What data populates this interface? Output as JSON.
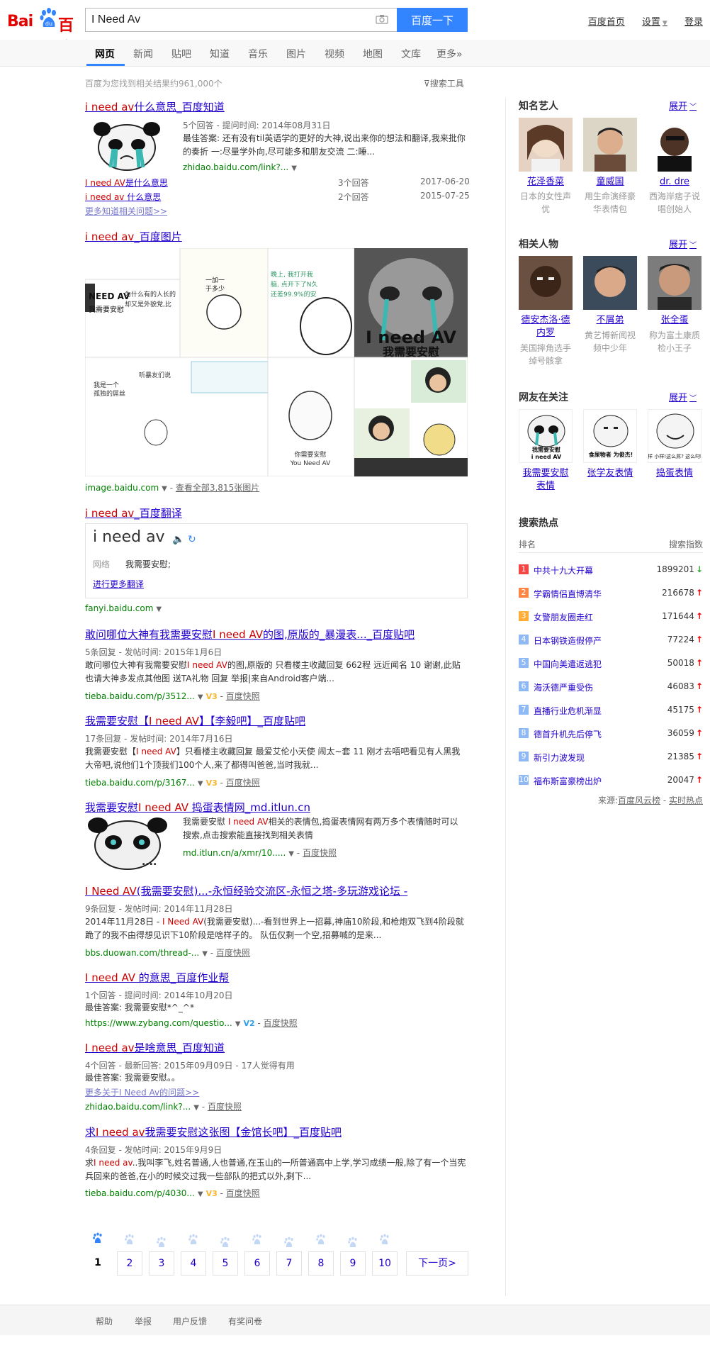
{
  "header": {
    "logo_left": "Bai",
    "logo_paw_text": "du",
    "logo_right": "百度",
    "search_value": "I Need Av",
    "search_button": "百度一下",
    "links": [
      "百度首页",
      "设置",
      "登录"
    ]
  },
  "tabs": [
    "网页",
    "新闻",
    "贴吧",
    "知道",
    "音乐",
    "图片",
    "视频",
    "地图",
    "文库",
    "更多»"
  ],
  "result_count": "百度为您找到相关结果约961,000个",
  "search_tools": "搜索工具",
  "results": {
    "zhidao1": {
      "title_em": "i need av",
      "title_rest": "什么意思_百度知道",
      "meta": "5个回答 - 提问时间: 2014年08月31日",
      "abstract": "最佳答案: 还有没有til英语学的更好的大神,说出来你的想法和翻译,我来批你的奏折 一:尽量学外向,尽可能多和朋友交流 二:睡...",
      "url": "zhidao.baidu.com/link?...",
      "sub1_em": "I need AV",
      "sub1_rest": "是什么意思",
      "sub1_count": "3个回答",
      "sub1_date": "2017-06-20",
      "sub2_em": "i need av",
      "sub2_rest": " 什么意思",
      "sub2_count": "2个回答",
      "sub2_date": "2015-07-25",
      "more": "更多知道相关问题>>"
    },
    "images": {
      "title_em": "i need av",
      "title_rest": "_百度图片",
      "url": "image.baidu.com",
      "view_all": "查看全部3,815张图片",
      "panda_caption": "I need AV",
      "panda_caption2": "我需要安慰",
      "meme_caption": "你需要安慰\nYou Need AV"
    },
    "fanyi": {
      "title_em": "i need av",
      "title_rest": "_百度翻译",
      "word": "i need av",
      "label": "网络",
      "meaning": "我需要安慰;",
      "more": "进行更多翻译",
      "url": "fanyi.baidu.com"
    },
    "tieba1": {
      "title_pre": "敢问哪位大神有我需要安慰",
      "title_em": "I need AV",
      "title_rest": "的图,原版的_暴漫表..._百度贴吧",
      "meta": "5条回复 - 发帖时间: 2015年1月6日",
      "abstract_pre": "敢问哪位大神有我需要安慰",
      "abstract_em": "I need AV",
      "abstract_rest": "的图,原版的 只看楼主收藏回复 662程 远近闻名 10 谢谢,此贴也请大神多发点其他图 送TA礼物 回复 举报|来自Android客户端...",
      "url": "tieba.baidu.com/p/3512...",
      "badge": "V3",
      "snapshot": "百度快照"
    },
    "tieba2": {
      "title_pre": "我需要安慰【",
      "title_em": "I need AV",
      "title_rest": "】【李毅吧】_百度贴吧",
      "meta": "17条回复 - 发帖时间: 2014年7月16日",
      "abstract_pre": "我需要安慰【",
      "abstract_em": "I need AV",
      "abstract_rest": "】只看楼主收藏回复 最爱艾伦小天使 闹太~套 11 刚才去唔吧看见有人黑我大帝吧,说他们1个顶我们100个人,来了都得叫爸爸,当时我就...",
      "url": "tieba.baidu.com/p/3167...",
      "badge": "V3",
      "snapshot": "百度快照"
    },
    "itlun": {
      "title_pre": "我需要安慰",
      "title_em": "I need AV",
      "title_rest": " 捣蛋表情网_md.itlun.cn",
      "abstract_pre": "我需要安慰 ",
      "abstract_em": "I need AV",
      "abstract_rest": "相关的表情包,捣蛋表情网有两万多个表情随时可以搜索,点击搜索能直接找到相关表情",
      "url": "md.itlun.cn/a/xmr/10.....",
      "snapshot": "百度快照"
    },
    "duowan": {
      "title_em": "I Need AV",
      "title_rest": "(我需要安慰)...-永恒经验交流区-永恒之塔-多玩游戏论坛 -",
      "meta": "9条回复 - 发帖时间: 2014年11月28日",
      "abstract_pre": "2014年11月28日 - ",
      "abstract_em": "I Need AV",
      "abstract_rest": "(我需要安慰)...-看到世界上一招募,神庙10阶段,和枪炮双飞到4阶段就跪了的我不由得想见识下10阶段是啥样子的。 队伍仅剩一个空,招募喊的是来...",
      "url": "bbs.duowan.com/thread-...",
      "snapshot": "百度快照"
    },
    "zybang": {
      "title_em": "I need AV",
      "title_rest": " 的意思_百度作业帮",
      "meta": "1个回答 - 提问时间: 2014年10月20日",
      "abstract": "最佳答案: 我需要安慰*^_^*",
      "url": "https://www.zybang.com/questio...",
      "badge": "V2",
      "snapshot": "百度快照"
    },
    "zhidao2": {
      "title_em": "I need av",
      "title_rest": "是啥意思_百度知道",
      "meta": "4个回答 - 最新回答: 2015年09月09日 - 17人觉得有用",
      "abstract": "最佳答案: 我需要安慰。。",
      "more": "更多关于I Need Av的问题>>",
      "url": "zhidao.baidu.com/link?...",
      "snapshot": "百度快照"
    },
    "tieba3": {
      "title_pre": "求",
      "title_em": "I need av",
      "title_rest": "我需要安慰这张图【金馆长吧】_百度贴吧",
      "meta": "4条回复 - 发帖时间: 2015年9月9日",
      "abstract_pre": "求",
      "abstract_em": "I need av",
      "abstract_rest": "..我叫李飞,姓名普通,人也普通,在玉山的一所普通高中上学,学习成绩一般,除了有一个当宪兵回来的爸爸,在小的时候交过我一些部队的把式以外,剩下...",
      "url": "tieba.baidu.com/p/4030...",
      "badge": "V3",
      "snapshot": "百度快照"
    }
  },
  "right": {
    "celebs": {
      "title": "知名艺人",
      "expand": "展开",
      "items": [
        {
          "name": "花泽香菜",
          "desc": "日本的女性声优"
        },
        {
          "name": "童威国",
          "desc": "用生命演绎豪华表情包"
        },
        {
          "name": "dr. dre",
          "desc": "西海岸痞子说唱创始人"
        }
      ]
    },
    "people": {
      "title": "相关人物",
      "expand": "展开",
      "items": [
        {
          "name": "德安杰洛·德内罗",
          "desc": "美国摔角选手绰号骸拿"
        },
        {
          "name": "不屑弟",
          "desc": "黄艺博新闻视频中少年"
        },
        {
          "name": "张全蛋",
          "desc": "称为富土康质检小王子"
        }
      ]
    },
    "netizens": {
      "title": "网友在关注",
      "expand": "展开",
      "items": [
        {
          "name": "我需要安慰表情",
          "caption": "我需要安慰\ni need AV"
        },
        {
          "name": "张学友表情",
          "caption": "食屎物者 为俊杰!"
        },
        {
          "name": "捣蛋表情",
          "caption": "小样 小样!这么屌? 这么叼啊?"
        }
      ]
    },
    "hot": {
      "title": "搜索热点",
      "col_rank": "排名",
      "col_index": "搜索指数",
      "items": [
        {
          "rank": "1",
          "text": "中共十九大开幕",
          "value": "1899201",
          "trend": "down"
        },
        {
          "rank": "2",
          "text": "学霸情侣直博清华",
          "value": "216678",
          "trend": "up"
        },
        {
          "rank": "3",
          "text": "女警朋友圈走红",
          "value": "171644",
          "trend": "up"
        },
        {
          "rank": "4",
          "text": "日本钢铁造假停产",
          "value": "77224",
          "trend": "up"
        },
        {
          "rank": "5",
          "text": "中国向美遣返逃犯",
          "value": "50018",
          "trend": "up"
        },
        {
          "rank": "6",
          "text": "海沃德严重受伤",
          "value": "46083",
          "trend": "up"
        },
        {
          "rank": "7",
          "text": "直播行业危机渐显",
          "value": "45175",
          "trend": "up"
        },
        {
          "rank": "8",
          "text": "德首升机先后停飞",
          "value": "36059",
          "trend": "up"
        },
        {
          "rank": "9",
          "text": "新引力波发现",
          "value": "21385",
          "trend": "up"
        },
        {
          "rank": "10",
          "text": "福布斯富豪榜出炉",
          "value": "20047",
          "trend": "up"
        }
      ],
      "source_label": "来源:",
      "source1": "百度风云榜",
      "source2": "实时热点"
    }
  },
  "pagination": {
    "pages": [
      "1",
      "2",
      "3",
      "4",
      "5",
      "6",
      "7",
      "8",
      "9",
      "10"
    ],
    "next": "下一页>"
  },
  "footer": [
    "帮助",
    "举报",
    "用户反馈",
    "有奖问卷"
  ],
  "colors": {
    "accent": "#3385ff",
    "link": "#2200cc",
    "highlight": "#cc0000",
    "url": "#008000",
    "logo": "#e10602"
  },
  "arrows": {
    "up": "↑",
    "down": "↓"
  }
}
